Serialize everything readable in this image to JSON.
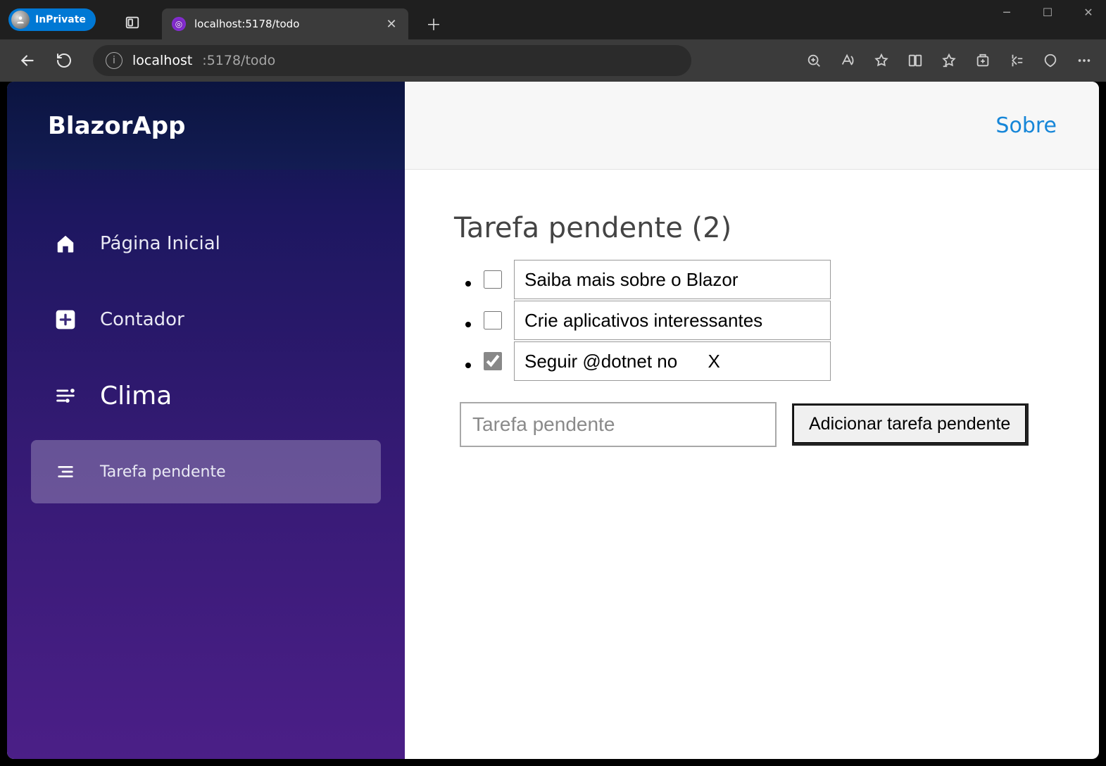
{
  "browser": {
    "inprivate_label": "InPrivate",
    "tab_title": "localhost:5178/todo",
    "url_host": "localhost",
    "url_path": ":5178/todo"
  },
  "sidebar": {
    "brand": "BlazorApp",
    "items": [
      {
        "label": "Página Inicial"
      },
      {
        "label": "Contador"
      },
      {
        "label": "Clima"
      },
      {
        "label": "Tarefa pendente"
      }
    ]
  },
  "header": {
    "about_label": "Sobre"
  },
  "todo": {
    "heading_prefix": "Tarefa pendente",
    "pending_count": "2",
    "items": [
      {
        "title": "Saiba mais sobre o Blazor",
        "done": false
      },
      {
        "title": "Crie aplicativos interessantes",
        "done": false
      },
      {
        "title": "Seguir @dotnet no      X",
        "done": true
      }
    ],
    "new_placeholder": "Tarefa pendente",
    "add_button_label": "Adicionar tarefa pendente"
  }
}
